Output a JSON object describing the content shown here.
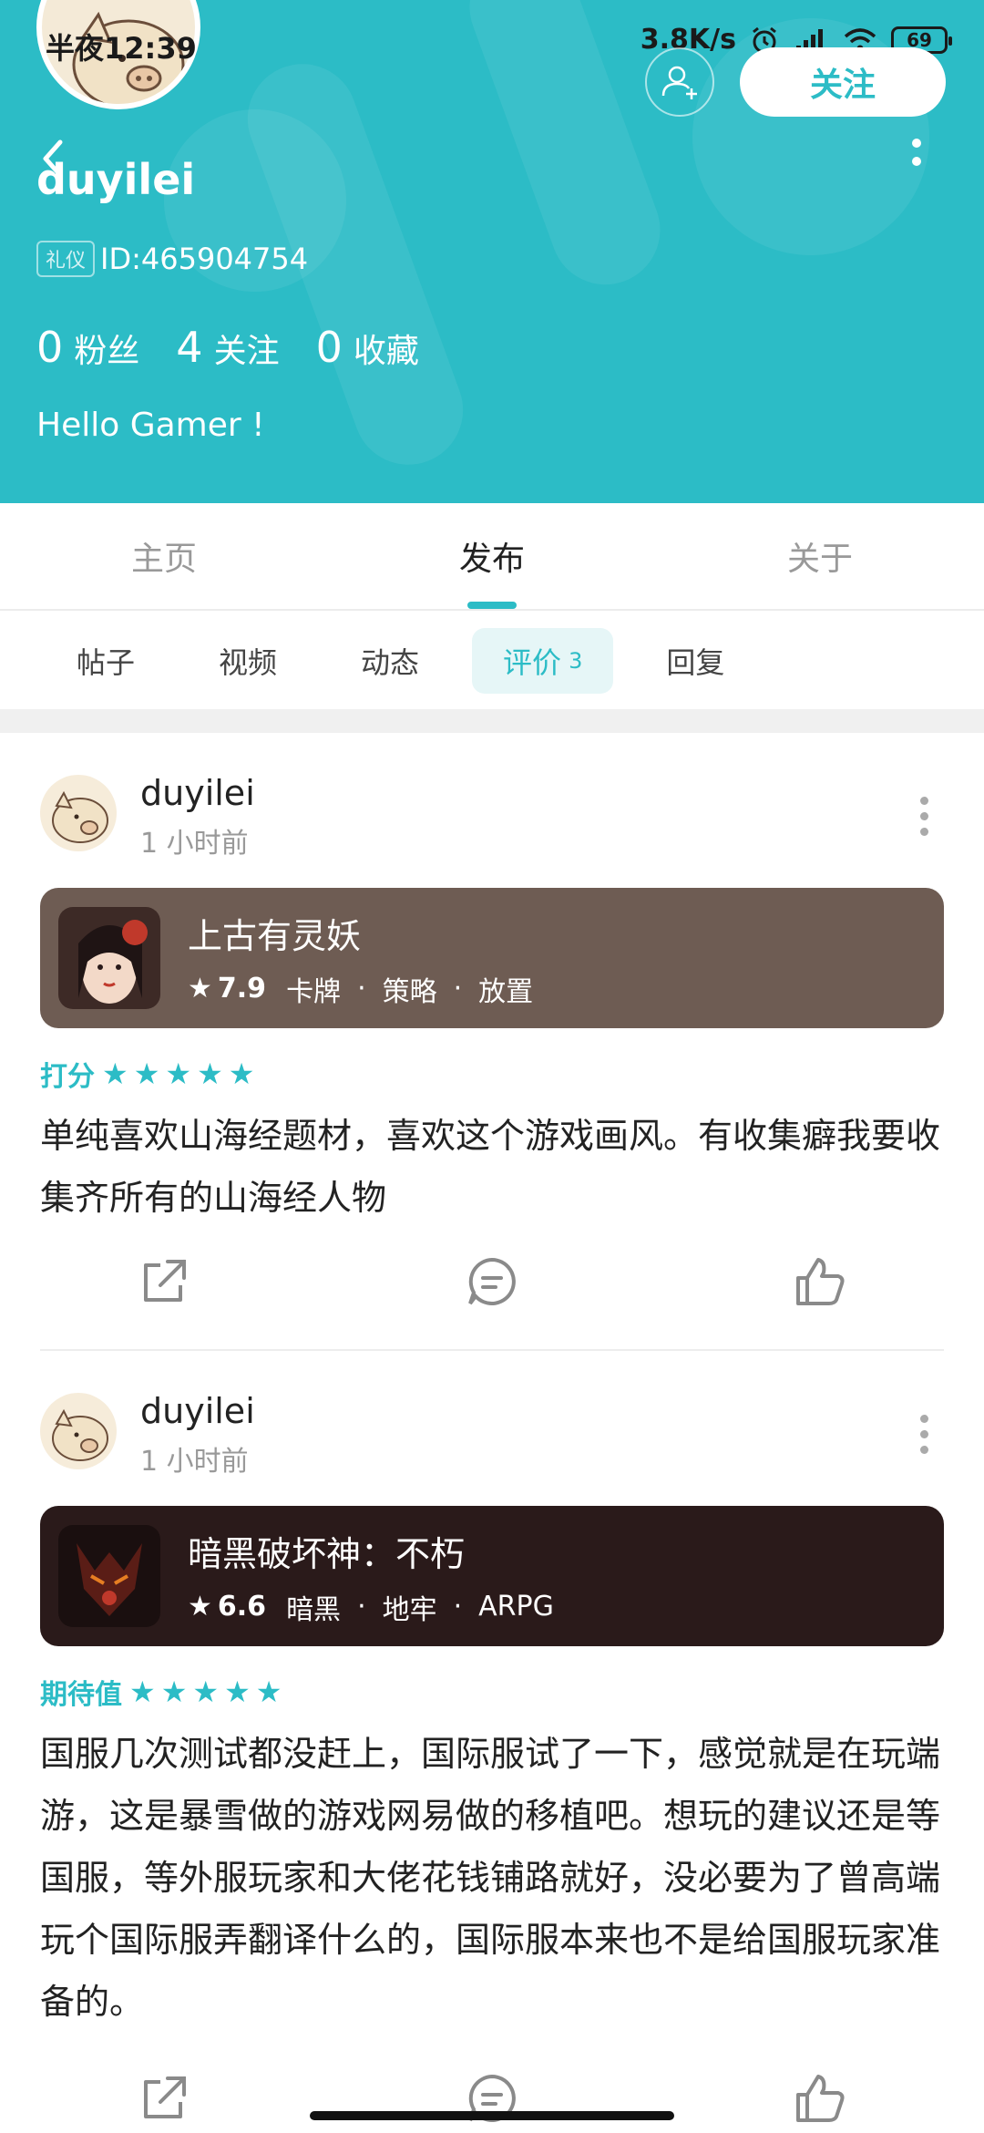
{
  "status_bar": {
    "time": "半夜12:39",
    "net_speed": "3.8K/s",
    "battery": "69",
    "icons": [
      "alarm-icon",
      "signal-icon",
      "wifi-icon",
      "battery-icon"
    ]
  },
  "profile": {
    "username": "duyilei",
    "badge": "礼仪",
    "id_text": "ID:465904754",
    "stats": [
      {
        "num": "0",
        "label": "粉丝"
      },
      {
        "num": "4",
        "label": "关注"
      },
      {
        "num": "0",
        "label": "收藏"
      }
    ],
    "bio": "Hello Gamer !",
    "follow_label": "关注",
    "header_color": "#2cbcc6"
  },
  "main_tabs": [
    {
      "label": "主页",
      "active": false
    },
    {
      "label": "发布",
      "active": true
    },
    {
      "label": "关于",
      "active": false
    }
  ],
  "sub_tabs": [
    {
      "label": "帖子",
      "count": ""
    },
    {
      "label": "视频",
      "count": ""
    },
    {
      "label": "动态",
      "count": ""
    },
    {
      "label": "评价",
      "count": "3",
      "active": true
    },
    {
      "label": "回复",
      "count": ""
    }
  ],
  "reviews": [
    {
      "author": "duyilei",
      "time": "1 小时前",
      "game": {
        "title": "上古有灵妖",
        "score": "7.9",
        "tags": [
          "卡牌",
          "策略",
          "放置"
        ],
        "card_color": "#6e5c53"
      },
      "rating_label": "打分",
      "stars": 5,
      "body": "单纯喜欢山海经题材，喜欢这个游戏画风。有收集癖我要收集齐所有的山海经人物"
    },
    {
      "author": "duyilei",
      "time": "1 小时前",
      "game": {
        "title": "暗黑破坏神：不朽",
        "score": "6.6",
        "tags": [
          "暗黑",
          "地牢",
          "ARPG"
        ],
        "card_color": "#2a1a1a"
      },
      "rating_label": "期待值",
      "stars": 5,
      "body": "国服几次测试都没赶上，国际服试了一下，感觉就是在玩端游，这是暴雪做的游戏网易做的移植吧。想玩的建议还是等国服，等外服玩家和大佬花钱铺路就好，没必要为了曾高端玩个国际服弄翻译什么的，国际服本来也不是给国服玩家准备的。"
    }
  ]
}
